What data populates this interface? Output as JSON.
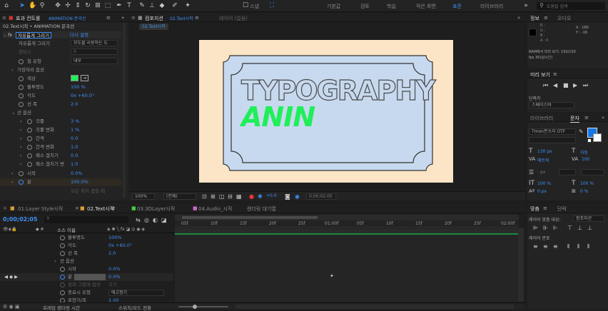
{
  "topbar": {
    "workspaces": [
      "기본값",
      "검토",
      "학습",
      "작은 화면",
      "표준",
      "라이브러리"
    ],
    "active_workspace": "표준",
    "search_placeholder": "도움말 검색",
    "snap_label": "스냅"
  },
  "effects_panel": {
    "tab": "효과 컨트롤",
    "tab_highlight": "ANIMATION 문국선",
    "breadcrumb": "02.Text시작 • ANIMATION 문국선",
    "fx": {
      "name": "자유롭게 그리기",
      "reset": "다시 설정"
    },
    "rows": [
      {
        "label": "자유롭게 그리기",
        "value": "모도를 사용하는 도"
      },
      {
        "label": "캔버스",
        "value": "B"
      },
      {
        "label": "칠 유형",
        "value": "내부"
      },
      {
        "label": "가장자리 옵션",
        "value": ""
      },
      {
        "label": "색상",
        "value": ""
      },
      {
        "label": "불투명도",
        "value": "100 %"
      },
      {
        "label": "각도",
        "value": "0x +60.0°"
      },
      {
        "label": "선 폭",
        "value": "2.0"
      },
      {
        "label": "선 옵션",
        "value": ""
      },
      {
        "label": "곡률",
        "value": "3 %"
      },
      {
        "label": "곡률 변화",
        "value": "1 %"
      },
      {
        "label": "간격",
        "value": "0.0"
      },
      {
        "label": "간격 변화",
        "value": "1.0"
      },
      {
        "label": "패스 겹치기",
        "value": "0.0"
      },
      {
        "label": "패스 겹치기 변",
        "value": "1.0"
      },
      {
        "label": "시작",
        "value": "0.0%"
      },
      {
        "label": "끝",
        "value": "100.0%"
      }
    ],
    "footer": "모든 획이 겹칠 때"
  },
  "comp_panel": {
    "tab": "컴포지션",
    "tab_highlight": "02.Text시작",
    "tab2": "레이어 (없음)",
    "subtab": "02.Text시작",
    "text_line1": "TYPOGRAPHY",
    "text_line2": "ANIN",
    "zoom": "100%",
    "resolution": "(전체)",
    "exposure": "+0.0",
    "timecode": "0;00;02;05"
  },
  "info_panel": {
    "tabs": [
      "정보",
      "오디오"
    ],
    "r_label": "R :",
    "g_label": "G :",
    "b_label": "B :",
    "a_label": "A : 0",
    "x": "X : 180",
    "y": "Y : -16",
    "ram": "RAM에서 미리 보기: 150/150",
    "fps": "fps 30(실시간)"
  },
  "preview_panel": {
    "title": "미리 보기",
    "shortcut_label": "단축키",
    "shortcut_value": "스페이스바"
  },
  "library_tabs": [
    "라이브러리",
    "문자"
  ],
  "char_panel": {
    "font": "Tmon몬소리 OTF",
    "size": "130 px",
    "size_mode": "자동",
    "tracking_label": "메트릭",
    "tracking": "100",
    "leading_unit": "- px",
    "vscale": "100 %",
    "hscale": "100 %",
    "baseline": "0 px",
    "tsume": "0 %"
  },
  "align_panel": {
    "tabs": [
      "맞춤",
      "단락"
    ],
    "align_to_label": "레이어 맞춤 대상:",
    "align_to_value": "컴포지션",
    "distribute_label": "레이어 분포"
  },
  "timeline": {
    "tabs": [
      "01.Layer Style시작",
      "02.Text시작",
      "03.3DLayer시작",
      "04.Audio_시작",
      "렌더링 대기열"
    ],
    "active_tab": "02.Text시작",
    "timecode": "0;00;02;05",
    "col_source": "소스 이름",
    "ruler": [
      "05f",
      "10f",
      "15f",
      "20f",
      "25f",
      "01:00f",
      "05f",
      "10f",
      "15f",
      "20f",
      "25f",
      "02:00f"
    ],
    "rows": [
      {
        "label": "불투명도",
        "value": "100%"
      },
      {
        "label": "각도",
        "value": "0x +60.0°"
      },
      {
        "label": "선 폭",
        "value": "2.0"
      },
      {
        "label": "선 옵션",
        "value": ""
      },
      {
        "label": "시작",
        "value": "0.0%"
      },
      {
        "label": "끝",
        "value": "0.0%"
      },
      {
        "label": "원래 그림에 합성",
        "value": "끄기"
      },
      {
        "label": "종료시 유형",
        "value": "애고정기"
      },
      {
        "label": "표현기/조",
        "value": "1.00"
      }
    ],
    "footer_left": "프레임 렌더링 시간",
    "footer_mid": "스위치/모드 전환"
  },
  "colors": {
    "accent": "#3f8ff5",
    "stroke_green": "#1fef58",
    "canvas_bg": "#fbe5c6",
    "ticket": "#c7d9ef",
    "fill_blue": "#1478e6"
  }
}
